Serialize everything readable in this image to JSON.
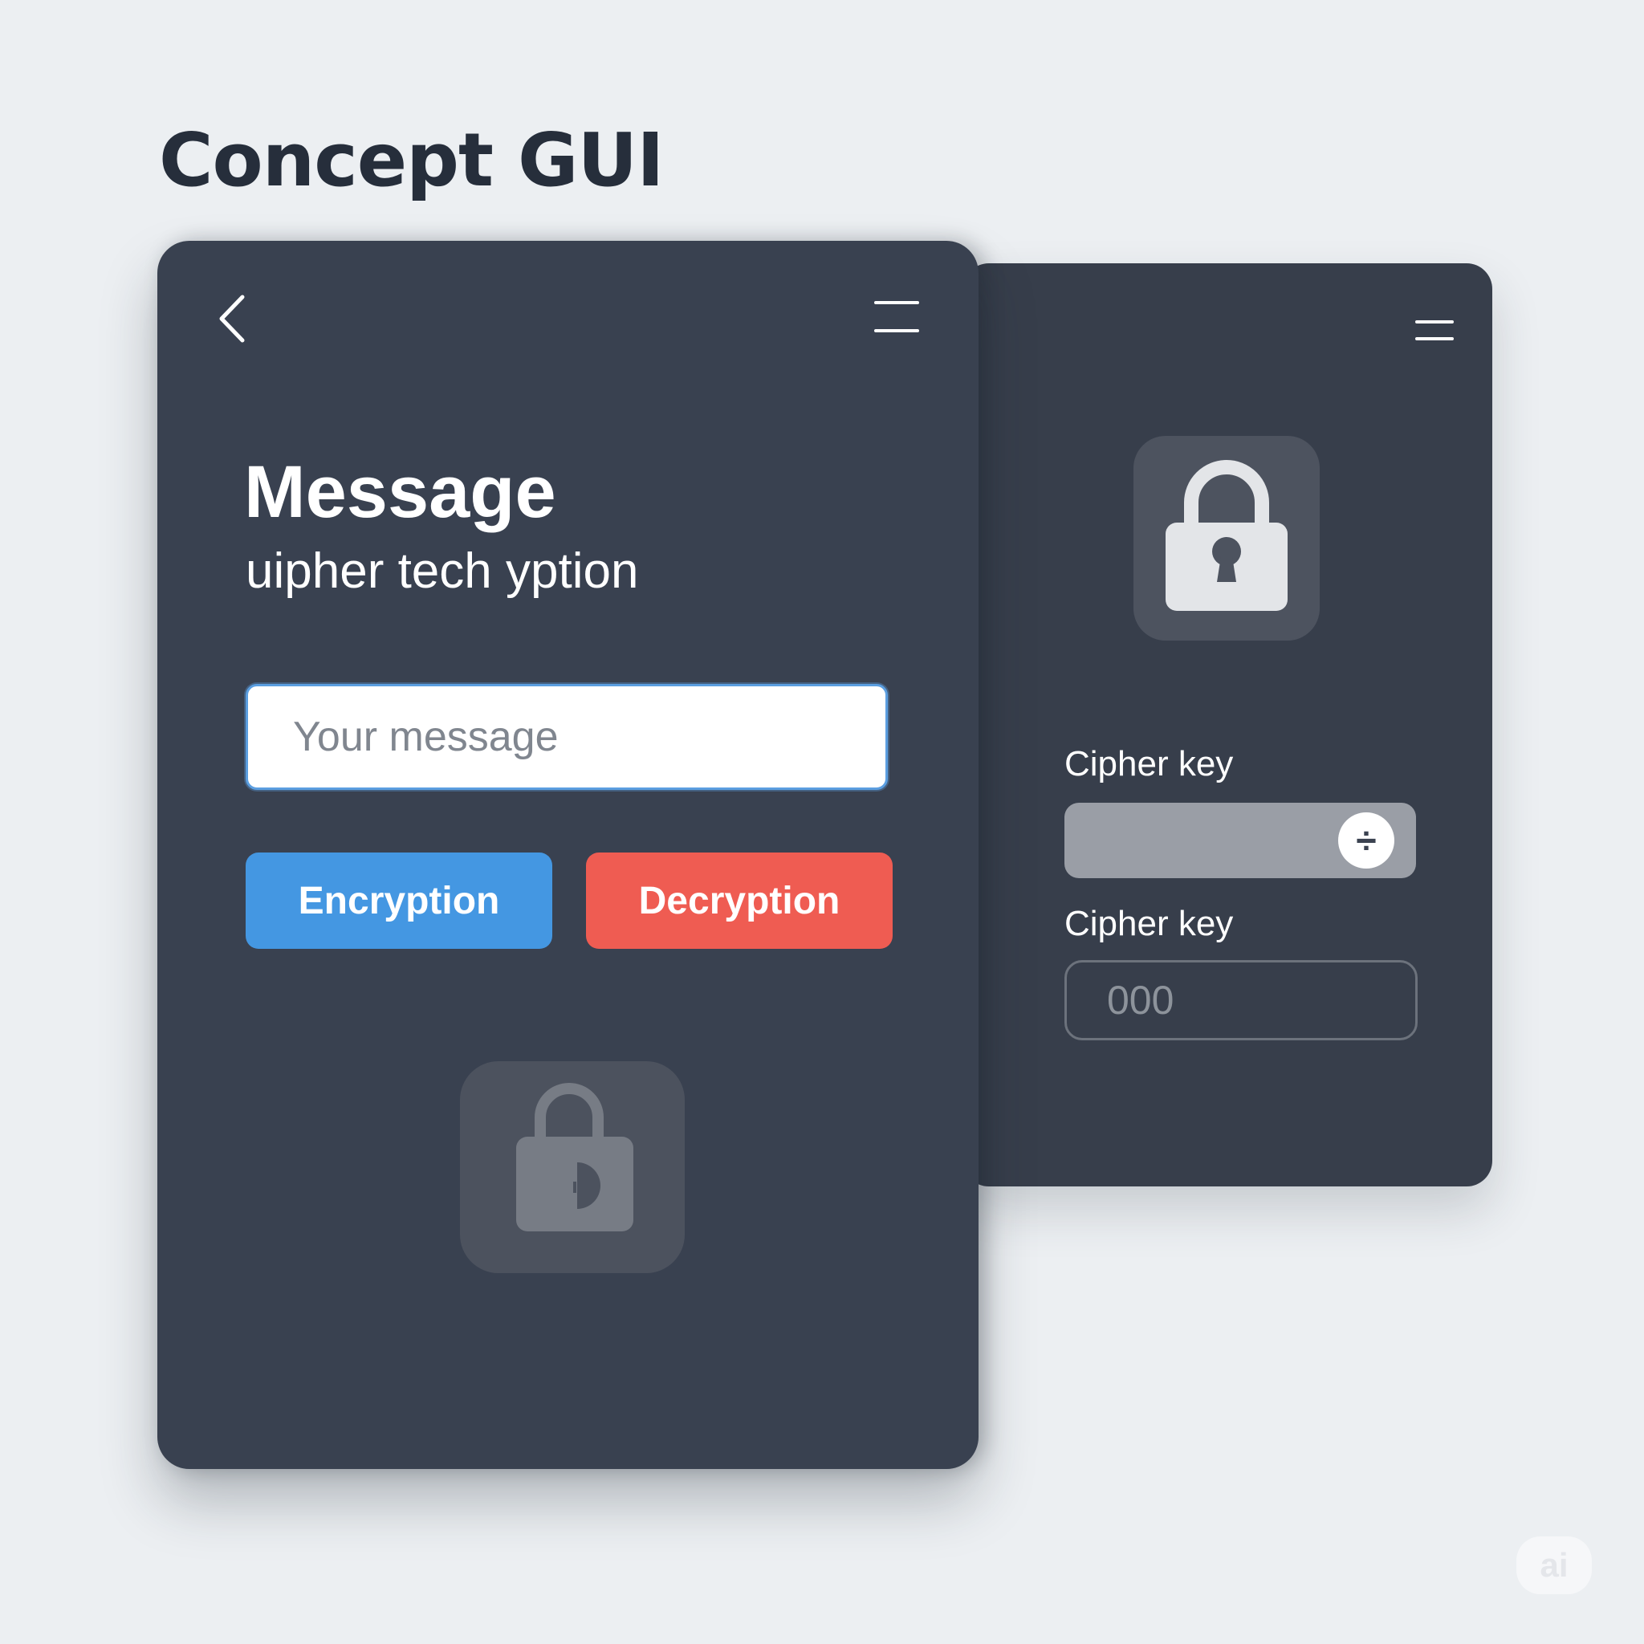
{
  "page": {
    "heading": "Concept GUI"
  },
  "message_panel": {
    "title": "Message",
    "subtitle": "uipher tech yption",
    "message_input": {
      "placeholder": "Your message",
      "value": ""
    },
    "encrypt_button_label": "Encryption",
    "decrypt_button_label": "Decryption",
    "icons": {
      "back": "chevron-left-icon",
      "menu": "hamburger-menu-icon",
      "lock": "padlock-icon"
    }
  },
  "key_panel": {
    "label_1": "Cipher key",
    "slider_knob_symbol": "÷",
    "label_2": "Cipher key",
    "key_input": {
      "placeholder": "000",
      "value": ""
    },
    "icons": {
      "menu": "hamburger-menu-icon",
      "lock": "padlock-icon"
    }
  },
  "watermark": "ai",
  "colors": {
    "background": "#eceff2",
    "panel": "#394150",
    "encrypt": "#4497e2",
    "decrypt": "#ef5c52",
    "input_focus": "#5b9ee0"
  }
}
